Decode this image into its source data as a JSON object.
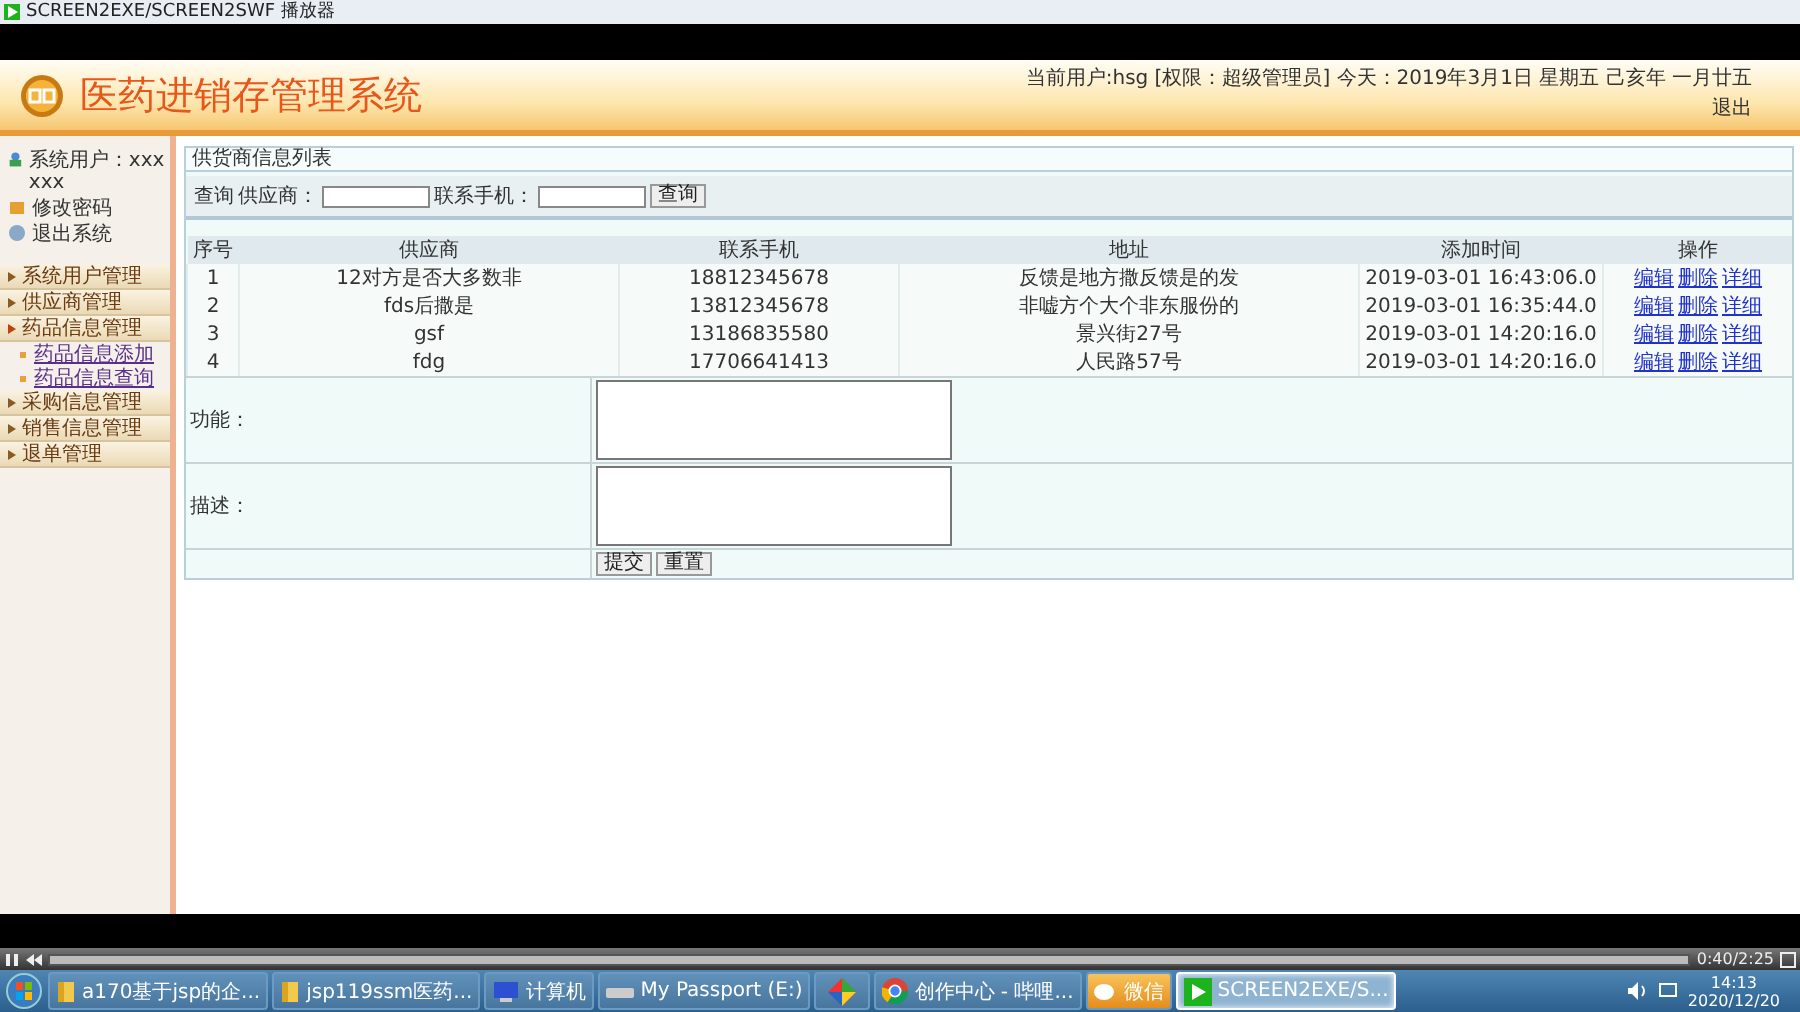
{
  "window": {
    "title": "SCREEN2EXE/SCREEN2SWF 播放器"
  },
  "header": {
    "title": "医药进销存管理系统",
    "user_info": "当前用户:hsg [权限：超级管理员] 今天：2019年3月1日 星期五 己亥年 一月廿五",
    "logout": "退出"
  },
  "sidebar": {
    "user_lines": [
      "系统用户：xxxxxx",
      "修改密码",
      "退出系统"
    ],
    "menu": [
      {
        "label": "系统用户管理",
        "expanded": false
      },
      {
        "label": "供应商管理",
        "expanded": false
      },
      {
        "label": "药品信息管理",
        "expanded": true,
        "children": [
          {
            "label": "药品信息添加"
          },
          {
            "label": "药品信息查询"
          }
        ]
      },
      {
        "label": "采购信息管理",
        "expanded": false
      },
      {
        "label": "销售信息管理",
        "expanded": false
      },
      {
        "label": "退单管理",
        "expanded": false
      }
    ]
  },
  "panel": {
    "title": "供货商信息列表",
    "search": {
      "label": "查询",
      "fields": [
        {
          "label": "供应商："
        },
        {
          "label": "联系手机："
        }
      ],
      "button": "查询"
    },
    "table": {
      "columns": [
        "序号",
        "供应商",
        "联系手机",
        "地址",
        "添加时间",
        "操作"
      ],
      "rows": [
        {
          "cells": [
            "1",
            "12对方是否大多数非",
            "18812345678",
            "反馈是地方撒反馈是的发",
            "2019-03-01 16:43:06.0"
          ],
          "actions": [
            "编辑",
            "删除",
            "详细"
          ]
        },
        {
          "cells": [
            "2",
            "fds后撒是",
            "13812345678",
            "非嘘方个大个非东服份的",
            "2019-03-01 16:35:44.0"
          ],
          "actions": [
            "编辑",
            "删除",
            "详细"
          ]
        },
        {
          "cells": [
            "3",
            "gsf",
            "13186835580",
            "景兴街27号",
            "2019-03-01 14:20:16.0"
          ],
          "actions": [
            "编辑",
            "删除",
            "详细"
          ]
        },
        {
          "cells": [
            "4",
            "fdg",
            "17706641413",
            "人民路57号",
            "2019-03-01 14:20:16.0"
          ],
          "actions": [
            "编辑",
            "删除",
            "详细"
          ]
        }
      ]
    },
    "form": {
      "fields": [
        {
          "label": "功能："
        },
        {
          "label": "描述："
        }
      ],
      "buttons": [
        "提交",
        "重置"
      ]
    }
  },
  "player": {
    "time": "0:40/2:25"
  },
  "taskbar": {
    "items": [
      {
        "kind": "folder",
        "label": "a170基于jsp的企...",
        "selected": false,
        "flashing": false
      },
      {
        "kind": "folder",
        "label": "jsp119ssm医药...",
        "selected": false,
        "flashing": false
      },
      {
        "kind": "computer",
        "label": "计算机",
        "selected": false,
        "flashing": false
      },
      {
        "kind": "drive",
        "label": "My Passport (E:)",
        "selected": false,
        "flashing": false
      },
      {
        "kind": "app",
        "selected": false,
        "flashing": false
      },
      {
        "kind": "browser",
        "label": "创作中心 - 哔哩...",
        "selected": false,
        "flashing": false
      },
      {
        "kind": "chat",
        "label": "微信",
        "selected": false,
        "flashing": true
      },
      {
        "kind": "player",
        "label": "SCREEN2EXE/S...",
        "selected": true,
        "flashing": false
      }
    ],
    "clock": {
      "time": "14:13",
      "date": "2020/12/20"
    }
  }
}
